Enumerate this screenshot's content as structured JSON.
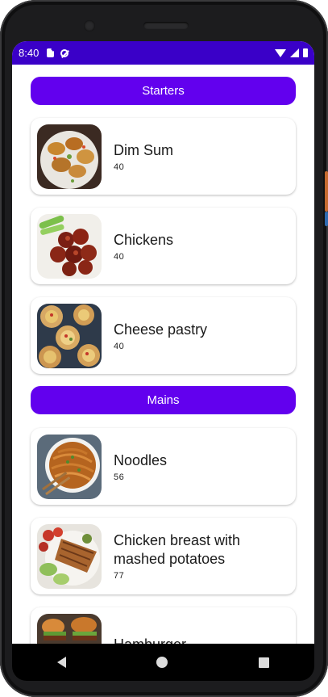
{
  "status_bar": {
    "time": "8:40",
    "background": "#3a00c8",
    "left_icons": [
      "sd-card-icon",
      "do-not-disturb-icon"
    ],
    "right_icons": [
      "wifi-icon",
      "signal-icon",
      "battery-icon"
    ]
  },
  "accent_color": "#6200ee",
  "sections": [
    {
      "label": "Starters",
      "items": [
        {
          "title": "Dim Sum",
          "value": "40"
        },
        {
          "title": "Chickens",
          "value": "40"
        },
        {
          "title": "Cheese pastry",
          "value": "40"
        }
      ]
    },
    {
      "label": "Mains",
      "items": [
        {
          "title": "Noodles",
          "value": "56"
        },
        {
          "title": "Chicken breast with mashed potatoes",
          "value": "77"
        },
        {
          "title": "Hamburger",
          "value": ""
        }
      ]
    }
  ],
  "nav_bar": {
    "icons": [
      "back-icon",
      "home-icon",
      "recents-icon"
    ]
  }
}
